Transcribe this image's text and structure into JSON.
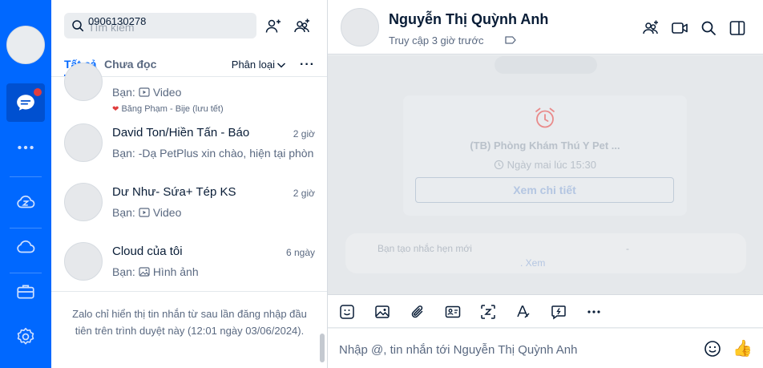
{
  "search": {
    "placeholder": "Tìm kiếm",
    "value": "0906130278"
  },
  "tabs": {
    "all": "Tất cả",
    "unread": "Chưa đọc",
    "filter": "Phân loại",
    "more": "···"
  },
  "conversations": [
    {
      "name": "",
      "time": "",
      "preview": "Bạn: ",
      "preview_kind": "Video",
      "sub": "Băng Phạm - Bije (lưu tết)"
    },
    {
      "name": "David Ton/Hiền Tấn - Báo",
      "time": "2 giờ",
      "preview": "Bạn: -Dạ PetPlus xin chào, hiện tại phòn"
    },
    {
      "name": "Dư Như-  Sứa+ Tép KS",
      "time": "2 giờ",
      "preview": "Bạn: ",
      "preview_kind": "Video"
    },
    {
      "name": "Cloud của tôi",
      "time": "6 ngày",
      "preview": "Bạn: ",
      "preview_kind": "Hình ảnh"
    }
  ],
  "notice": "Zalo chỉ hiển thị tin nhắn từ sau lần đăng nhập đầu tiên trên trình duyệt này (12:01 ngày 03/06/2024).",
  "chat": {
    "name": "Nguyễn Thị Quỳnh Anh",
    "status": "Truy cập 3 giờ trước",
    "reminder": {
      "title": "(TB) Phòng Khám Thú Y Pet ...",
      "time": "Ngày mai lúc 15:30",
      "button": "Xem chi tiết"
    },
    "system": {
      "text": "Bạn tạo nhắc hẹn mới",
      "link": ". Xem",
      "dash": "-"
    },
    "composer_placeholder": "Nhập @, tin nhắn tới Nguyễn Thị Quỳnh Anh",
    "thumb": "👍"
  },
  "colors": {
    "brand": "#0068ff",
    "rail_active": "#0050d0",
    "badge": "#e03d3d",
    "alarm": "#e98b8b"
  },
  "icons": [
    "chat-icon",
    "more-icon",
    "cloud-z-icon",
    "cloud-icon",
    "briefcase-icon",
    "settings-icon",
    "search-icon",
    "add-friend-icon",
    "create-group-icon",
    "video-call-icon",
    "sidebar-toggle-icon",
    "tag-icon",
    "alarm-icon",
    "sticker-icon",
    "image-icon",
    "attach-icon",
    "contact-card-icon",
    "screenshot-icon",
    "format-icon",
    "quick-message-icon",
    "emoji-icon"
  ]
}
